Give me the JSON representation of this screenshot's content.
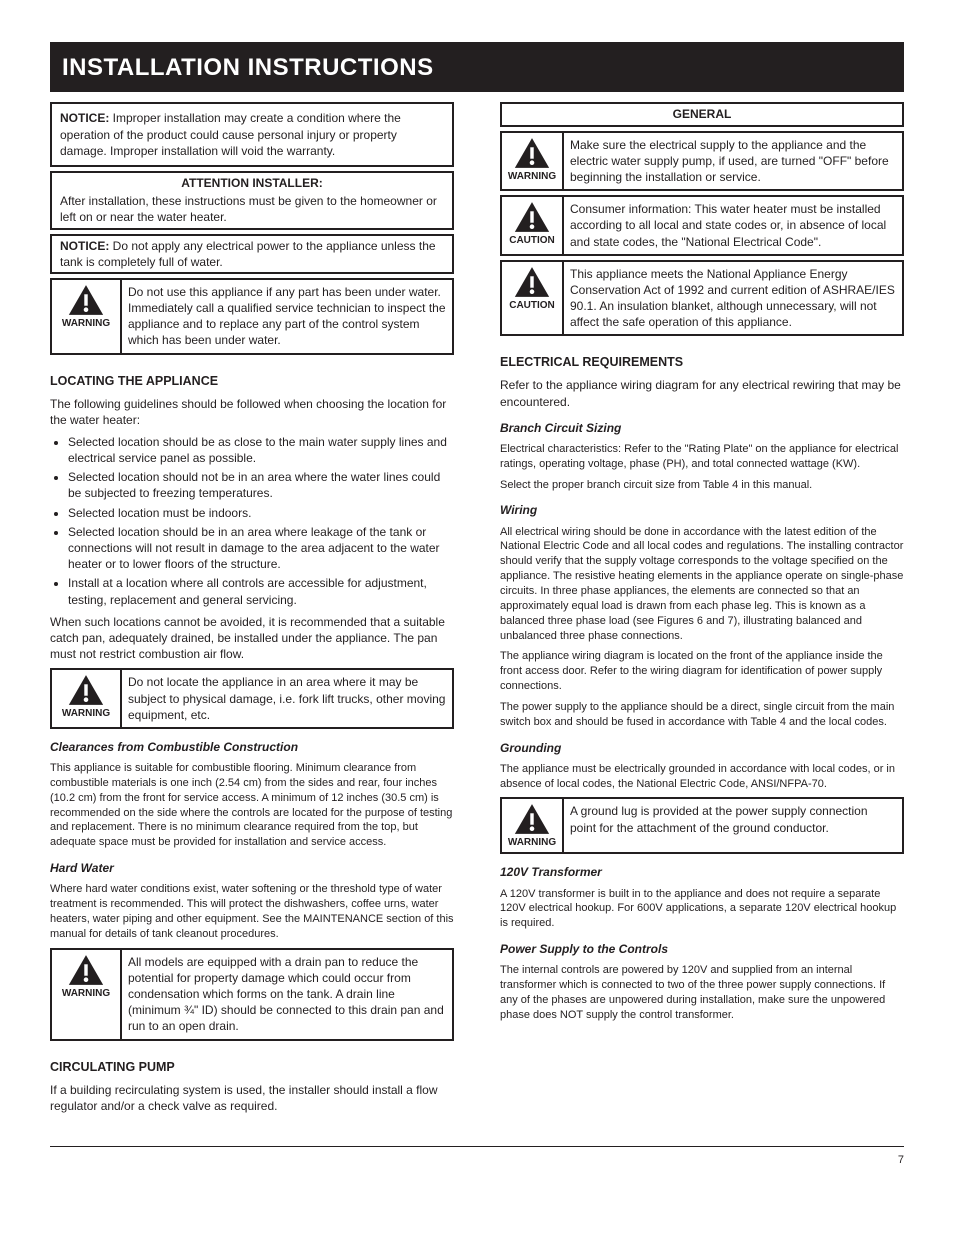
{
  "titlebar": {
    "title": "INSTALLATION INSTRUCTIONS"
  },
  "left": {
    "notice1_label": "NOTICE:",
    "notice1_text": " Improper installation may create a condition where the operation of the product could cause personal injury or property damage. Improper installation will void the warranty.",
    "attention_label": "ATTENTION INSTALLER:",
    "attention_text": " After installation, these instructions must be given to the homeowner or left on or near the water heater.",
    "notice2_label": "NOTICE:",
    "notice2_text": " Do not apply any electrical power to the appliance unless the tank is completely full of water.",
    "warn_box1_label": "WARNING",
    "warn_box1_text": "Do not use this appliance if any part has been under water. Immediately call a qualified service technician to inspect the appliance and to replace any part of the control system which has been under water.",
    "locating_heading": "LOCATING THE APPLIANCE",
    "locating_p1": "The following guidelines should be followed when choosing the location for the water heater:",
    "locating_bullets": [
      "Selected location should be as close to the main water supply lines and electrical service panel as possible.",
      "Selected location should not be in an area where the water lines could be subjected to freezing temperatures.",
      "Selected location must be indoors.",
      "Selected location should be in an area where leakage of the tank or connections will not result in damage to the area adjacent to the water heater or to lower floors of the structure.",
      "Install at a location where all controls are accessible for adjustment, testing, replacement and general servicing."
    ],
    "locating_p2": "When such locations cannot be avoided, it is recommended that a suitable catch pan, adequately drained, be installed under the appliance. The pan must not restrict combustion air flow.",
    "warn_box2_label": "WARNING",
    "warn_box2_text": "Do not locate the appliance in an area where it may be subject to physical damage, i.e. fork lift trucks, other moving equipment, etc.",
    "sub_combustible": "Clearances from Combustible Construction",
    "clearance_p1": "This appliance is suitable for combustible flooring. Minimum clearance from combustible materials is one inch (2.54 cm) from the sides and rear, four inches (10.2 cm) from the front for service access. A minimum of 12 inches (30.5 cm) is recommended on the side where the controls are located for the purpose of testing and replacement. There is no minimum clearance required from the top, but adequate space must be provided for installation and service access.",
    "sub_hardwater": "Hard Water",
    "hardwater_p1": "Where hard water conditions exist, water softening or the threshold type of water treatment is recommended. This will protect the dishwashers, coffee urns, water heaters, water piping and other equipment. See the MAINTENANCE section of this manual for details of tank cleanout procedures.",
    "warn_box3_label": "WARNING",
    "warn_box3_text": "All models are equipped with a drain pan to reduce the potential for property damage which could occur from condensation which forms on the tank. A drain line (minimum ¾\" ID) should be connected to this drain pan and run to an open drain.",
    "circ_heading": "CIRCULATING PUMP",
    "circ_p1": "If a building recirculating system is used, the installer should install a flow regulator and/or a check valve as required."
  },
  "right": {
    "header_label": "GENERAL",
    "warn_a_label": "WARNING",
    "warn_a_text": "Make sure the electrical supply to the appliance and the electric water supply pump, if used, are turned \"OFF\" before beginning the installation or service.",
    "warn_b_label": "CAUTION",
    "warn_b_text": "Consumer information: This water heater must be installed according to all local and state codes or, in absence of local and state codes, the \"National Electrical Code\".",
    "warn_c_label": "CAUTION",
    "warn_c_text": "This appliance meets the National Appliance Energy Conservation Act of 1992 and current edition of ASHRAE/IES 90.1. An insulation blanket, although unnecessary, will not affect the safe operation of this appliance.",
    "elec_heading": "ELECTRICAL REQUIREMENTS",
    "elec_p1": "Refer to the appliance wiring diagram for any electrical rewiring that may be encountered.",
    "branch_sub": "Branch Circuit Sizing",
    "branch_p1a": "Electrical characteristics: Refer to the \"Rating Plate\" on the appliance for electrical ratings, operating voltage, phase (PH), and total connected wattage (KW).",
    "branch_p1b": "Select the proper branch circuit size from Table 4 in this manual.",
    "wiring_sub": "Wiring",
    "wiring_p1": "All electrical wiring should be done in accordance with the latest edition of the National Electric Code and all local codes and regulations. The installing contractor should verify that the supply voltage corresponds to the voltage specified on the appliance. The resistive heating elements in the appliance operate on single-phase circuits. In three phase appliances, the elements are connected so that an approximately equal load is drawn from each phase leg. This is known as a balanced three phase load (see Figures 6 and 7), illustrating balanced and unbalanced three phase connections.",
    "wiring_p2": "The appliance wiring diagram is located on the front of the appliance inside the front access door. Refer to the wiring diagram for identification of power supply connections.",
    "wiring_p3": "The power supply to the appliance should be a direct, single circuit from the main switch box and should be fused in accordance with Table 4 and the local codes.",
    "grounding_sub": "Grounding",
    "grounding_p": "The appliance must be electrically grounded in accordance with local codes, or in absence of local codes, the National Electric Code, ANSI/NFPA-70.",
    "warn_d_label": "WARNING",
    "warn_d_text": "A ground lug is provided at the power supply connection point for the attachment of the ground conductor.",
    "transformer_sub": "120V Transformer",
    "transformer_p": "A 120V transformer is built in to the appliance and does not require a separate 120V electrical hookup. For 600V applications, a separate 120V electrical hookup is required.",
    "controls_sub": "Power Supply to the Controls",
    "controls_p": "The internal controls are powered by 120V and supplied from an internal transformer which is connected to two of the three power supply connections. If any of the phases are unpowered during installation, make sure the unpowered phase does NOT supply the control transformer."
  },
  "footer": {
    "left": "",
    "right": "7"
  }
}
